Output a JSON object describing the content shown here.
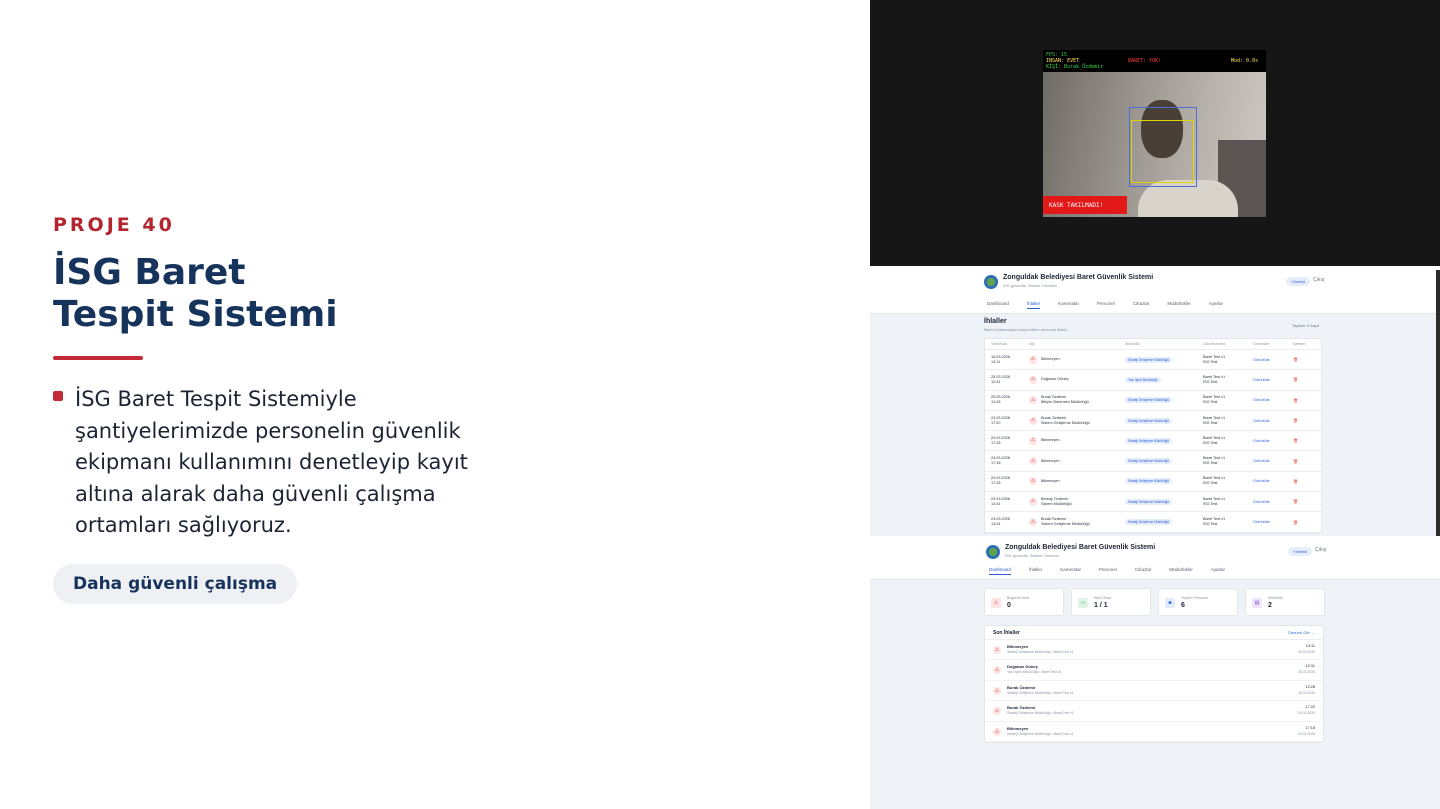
{
  "slide": {
    "eyebrow": "PROJE 40",
    "title_line1": "İSG Baret",
    "title_line2": "Tespit Sistemi",
    "bullet": "İSG Baret Tespit Sistemiyle şantiyelerimizde personelin güvenlik ekipmanı kullanımını denetleyip kayıt altına alarak daha güvenli çalışma ortamları sağlıyoruz.",
    "pill": "Daha güvenli çalışma"
  },
  "camera": {
    "fps": "FPS: 15",
    "insan": "INSAN: EVET",
    "kisi": "KİŞİ: Burak_Özdemir",
    "baret": "BARET: YOK!",
    "mod": "Mod: 0.0s",
    "alert": "KASK TAKILMADI!"
  },
  "app": {
    "title": "Zonguldak Belediyesi Baret Güvenlik Sistemi",
    "subtitle": "İSG güvenlik, Sistem Yönetimi",
    "badge": "Yönetici",
    "exit": "Çıkış",
    "tabs": [
      "Dashboard",
      "İhlaller",
      "Kameralar",
      "Personel",
      "Cihazlar",
      "Müdürlükler",
      "Ayarlar"
    ]
  },
  "violations": {
    "title": "İhlaller",
    "subtitle": "Baret kullanmayan tespit edilen personel listesi",
    "total": "Toplam: 9 kayıt",
    "columns": [
      "Tarih/Saat",
      "Kişi",
      "Müdürlük",
      "Cihaz/Kamera",
      "Görüntüler",
      "İşlemler"
    ],
    "rows": [
      {
        "date": "16.03.2026",
        "time": "13:11",
        "name": "Bilinmeyen",
        "sub": "",
        "dept": "Strateji Geliştirme Müdürlüğü",
        "cam": "Baret Test v1",
        "cam_sub": "ISG Test",
        "img": "Görüntüle"
      },
      {
        "date": "25.03.2026",
        "time": "12:31",
        "name": "Doğukan Güneş",
        "sub": "",
        "dept": "Yazı İşleri Müdürlüğü",
        "cam": "Baret Test v1",
        "cam_sub": "ISG Test",
        "img": "Görüntüle"
      },
      {
        "date": "25.03.2026",
        "time": "12:28",
        "name": "Burak Özdemir",
        "sub": "Bilişim Sistemleri Müdürlüğü",
        "dept": "Strateji Geliştirme Müdürlüğü",
        "cam": "Baret Test v1",
        "cam_sub": "ISG Test",
        "img": "Görüntüle"
      },
      {
        "date": "24.03.2026",
        "time": "17:20",
        "name": "Burak Özdemir",
        "sub": "Sistem Geliştirme Müdürlüğü",
        "dept": "Strateji Geliştirme Müdürlüğü",
        "cam": "Baret Test v1",
        "cam_sub": "ISG Test",
        "img": "Görüntüle"
      },
      {
        "date": "24.03.2026",
        "time": "17:18",
        "name": "Bilinmeyen",
        "sub": "",
        "dept": "Strateji Geliştirme Müdürlüğü",
        "cam": "Baret Test v1",
        "cam_sub": "ISG Test",
        "img": "Görüntüle"
      },
      {
        "date": "24.03.2026",
        "time": "17:18",
        "name": "Bilinmeyen",
        "sub": "",
        "dept": "Strateji Geliştirme Müdürlüğü",
        "cam": "Baret Test v1",
        "cam_sub": "ISG Test",
        "img": "Görüntüle"
      },
      {
        "date": "24.03.2026",
        "time": "17:18",
        "name": "Bilinmeyen",
        "sub": "",
        "dept": "Strateji Geliştirme Müdürlüğü",
        "cam": "Baret Test v1",
        "cam_sub": "ISG Test",
        "img": "Görüntüle"
      },
      {
        "date": "24.03.2026",
        "time": "13:31",
        "name": "Berkay Özdemir",
        "sub": "Sistem Müdürlüğü",
        "dept": "Strateji Geliştirme Müdürlüğü",
        "cam": "Baret Test v1",
        "cam_sub": "ISG Test",
        "img": "Görüntüle"
      },
      {
        "date": "24.03.2026",
        "time": "13:24",
        "name": "Burak Özdemir",
        "sub": "Sistem Geliştirme Müdürlüğü",
        "dept": "Strateji Geliştirme Müdürlüğü",
        "cam": "Baret Test v1",
        "cam_sub": "ISG Test",
        "img": "Görüntüle"
      }
    ]
  },
  "dashboard": {
    "cards": [
      {
        "label": "Bugünkü İhlal",
        "value": "0"
      },
      {
        "label": "Aktif Cihaz",
        "value": "1 / 1"
      },
      {
        "label": "Toplam Personel",
        "value": "6"
      },
      {
        "label": "Müdürlük",
        "value": "2"
      }
    ],
    "recent_title": "Son İhlaller",
    "recent_link": "Tümünü Gör →",
    "recent": [
      {
        "name": "Bilinmeyen",
        "sub": "Strateji Geliştirme Müdürlüğü • Baret Test v1",
        "time": "13:11",
        "date": "26.03.2026"
      },
      {
        "name": "Doğukan Güneş",
        "sub": "Yazı İşleri Müdürlüğü • Baret Test v1",
        "time": "12:31",
        "date": "25.03.2026"
      },
      {
        "name": "Burak Özdemir",
        "sub": "Strateji Geliştirme Müdürlüğü • Baret Test v1",
        "time": "12:28",
        "date": "25.03.2026"
      },
      {
        "name": "Burak Özdemir",
        "sub": "Strateji Geliştirme Müdürlüğü • Baret Test v1",
        "time": "17:20",
        "date": "24.03.2026"
      },
      {
        "name": "Bilinmeyen",
        "sub": "Strateji Geliştirme Müdürlüğü • Baret Test v1",
        "time": "17:18",
        "date": "24.03.2026"
      }
    ]
  },
  "colors": {
    "accent_red": "#c42a35",
    "navy": "#16335c",
    "link_blue": "#2c5fd6"
  }
}
